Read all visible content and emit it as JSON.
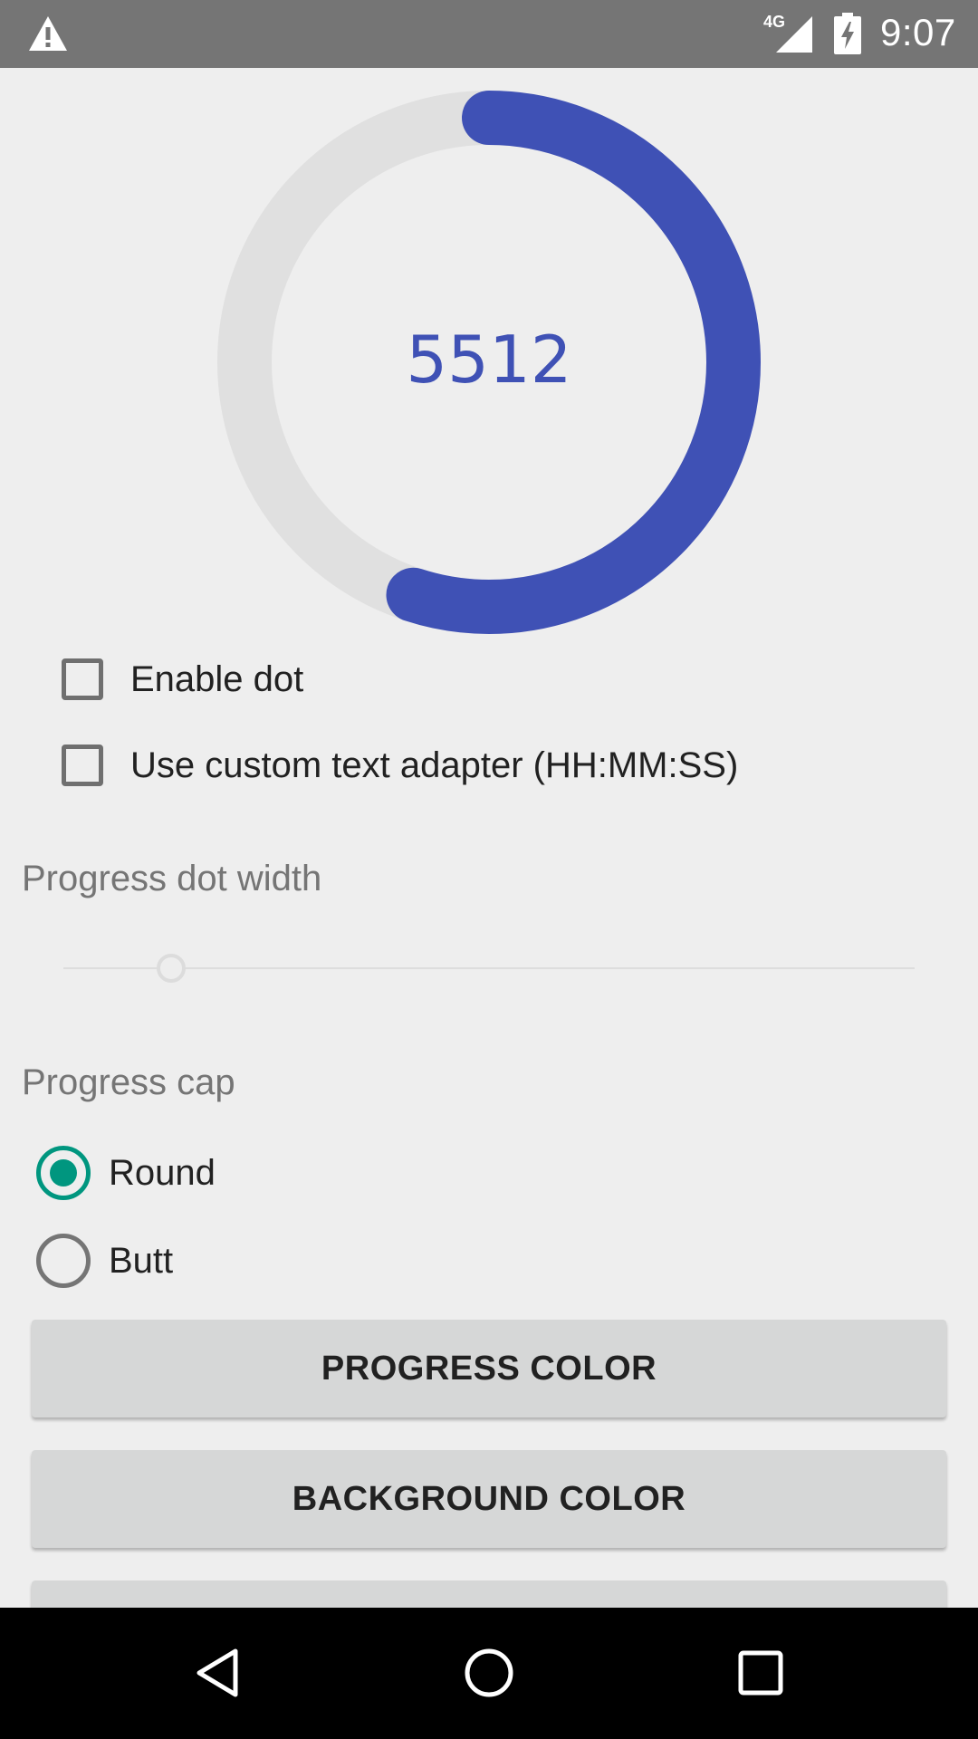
{
  "status_bar": {
    "network_label": "4G",
    "time": "9:07",
    "icons": [
      "warning-icon",
      "signal-icon",
      "battery-charging-icon"
    ]
  },
  "progress": {
    "value_text": "5512",
    "fraction": 0.55,
    "progress_color": "#3f51b5",
    "track_color": "#e0e0e0",
    "cap": "round"
  },
  "options": {
    "enable_dot_label": "Enable dot",
    "enable_dot_checked": false,
    "custom_adapter_label": "Use custom text adapter (HH:MM:SS)",
    "custom_adapter_checked": false
  },
  "dot_width": {
    "title": "Progress dot width",
    "enabled": false
  },
  "cap_section": {
    "title": "Progress cap",
    "options": [
      {
        "label": "Round",
        "selected": true
      },
      {
        "label": "Butt",
        "selected": false
      }
    ],
    "accent_color": "#00967f"
  },
  "buttons": {
    "progress_color_label": "PROGRESS COLOR",
    "background_color_label": "BACKGROUND COLOR",
    "third_label": ""
  },
  "nav": {
    "icons": [
      "back-icon",
      "home-icon",
      "recents-icon"
    ]
  }
}
